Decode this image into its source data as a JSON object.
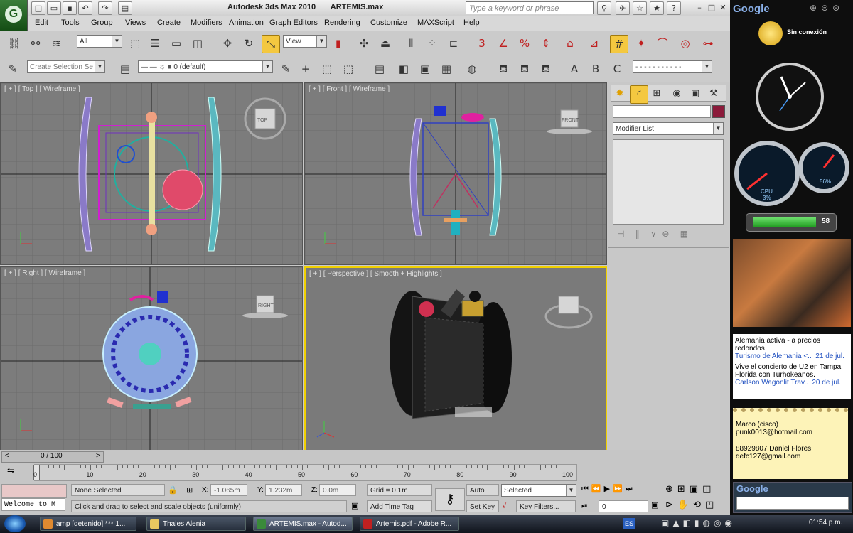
{
  "app": {
    "name": "Autodesk 3ds Max 2010",
    "file": "ARTEMIS.max",
    "search_placeholder": "Type a keyword or phrase"
  },
  "menu": [
    "Edit",
    "Tools",
    "Group",
    "Views",
    "Create",
    "Modifiers",
    "Animation",
    "Graph Editors",
    "Rendering",
    "Customize",
    "MAXScript",
    "Help"
  ],
  "toolbar": {
    "filter_value": "All",
    "refcoord_value": "View",
    "selection_set_placeholder": "Create Selection Se",
    "layer_value": "0 (default)",
    "snap_label": "3"
  },
  "viewports": [
    {
      "label": "[ + ] [ Top ] [ Wireframe ]",
      "cube": "TOP"
    },
    {
      "label": "[ + ] [ Front ] [ Wireframe ]",
      "cube": "FRONT"
    },
    {
      "label": "[ + ] [ Right ] [ Wireframe ]",
      "cube": "RIGHT"
    },
    {
      "label": "[ + ] [ Perspective ] [ Smooth + Highlights ]",
      "cube": ""
    }
  ],
  "command_panel": {
    "modifier_list": "Modifier List",
    "accent_color": "#8b1a3a"
  },
  "timeline": {
    "frame_display": "0 / 100",
    "ticks": [
      "0",
      "10",
      "20",
      "30",
      "40",
      "50",
      "60",
      "70",
      "80",
      "90",
      "100"
    ]
  },
  "status": {
    "selection": "None Selected",
    "x_label": "X:",
    "x_value": "-1.065m",
    "y_label": "Y:",
    "y_value": "1.232m",
    "z_label": "Z:",
    "z_value": "0.0m",
    "grid": "Grid = 0.1m",
    "prompt": "Click and drag to select and scale objects (uniformly)",
    "add_time_tag": "Add Time Tag",
    "auto_key": "Auto Key",
    "set_key": "Set Key",
    "selected_value": "Selected",
    "key_filters": "Key Filters...",
    "frame_field": "0",
    "maxscript": "Welcome to M"
  },
  "sidebar": {
    "google_title": "Google",
    "weather_status": "Sin conexión",
    "cpu_label": "CPU",
    "cpu_value": "3%",
    "mem_value": "56%",
    "battery_value": "58",
    "news": [
      {
        "headline": "Alemania activa - a precios redondos",
        "source": "Turismo de Alemania <..",
        "date": "21 de jul."
      },
      {
        "headline": "Vive el concierto de U2 en Tampa, Florida con Turhokeanos.",
        "source": "Carlson Wagonlit Trav..",
        "date": "20 de jul."
      }
    ],
    "notes": [
      "Marco (cisco)",
      "punk0013@hotmail.com",
      "",
      "88929807 Daniel Flores",
      "defc127@gmail.com"
    ],
    "google_search_logo": "Google"
  },
  "taskbar": {
    "tasks": [
      "amp [detenido] *** 1...",
      "Thales Alenia",
      "ARTEMIS.max - Autod...",
      "Artemis.pdf - Adobe R..."
    ],
    "lang": "ES",
    "clock": "01:54 p.m."
  }
}
